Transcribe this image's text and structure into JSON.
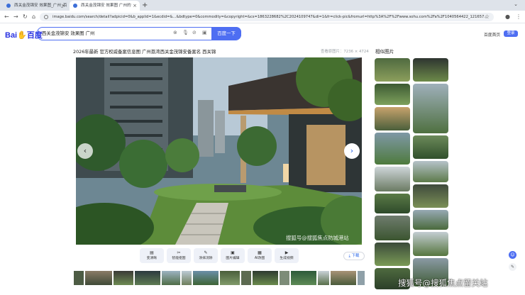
{
  "browser": {
    "tabs": [
      {
        "label": "西关金茂锦安 效果图_广州_百"
      },
      {
        "label": "西关金茂锦安 效果图 广州的"
      }
    ],
    "url": "image.baidu.com/search/detail?adpicid=0&b_applid=1&ecdid=&...&bdtype=0&commodity=&copyright=&cs=1863228682%2C2024109747&di=1&fr=click-pic&fromurl=http%3A%2F%2Fwww.sohu.com%2Fa%2F1040564422_121657..."
  },
  "header": {
    "logo_text": "Bai",
    "logo_text2": "百度",
    "search_query": "西关金茂锦安 效果图 广州",
    "search_button": "百度一下",
    "home_link": "百度首页",
    "login_button": "登录"
  },
  "main": {
    "title": "2026年最新 官方权威备案信息图 广州荔湾西关金茂锦安备案名 西关锦",
    "dimensions": "查看原图片：7236 × 4724",
    "related_title": "相似图片",
    "watermark": "搜狐号@搜狐焦点防城港站",
    "toolbar": [
      {
        "label": "变清晰"
      },
      {
        "label": "智能抠图"
      },
      {
        "label": "涂抹消除"
      },
      {
        "label": "图片编辑"
      },
      {
        "label": "AI改图"
      },
      {
        "label": "生成视频"
      }
    ],
    "download_label": "下载"
  },
  "bottom_watermark": "搜狐号@搜狐焦点留关站",
  "colors": {
    "accent": "#4e6ef2",
    "logo_red": "#e10602",
    "logo_blue": "#2932e1"
  }
}
